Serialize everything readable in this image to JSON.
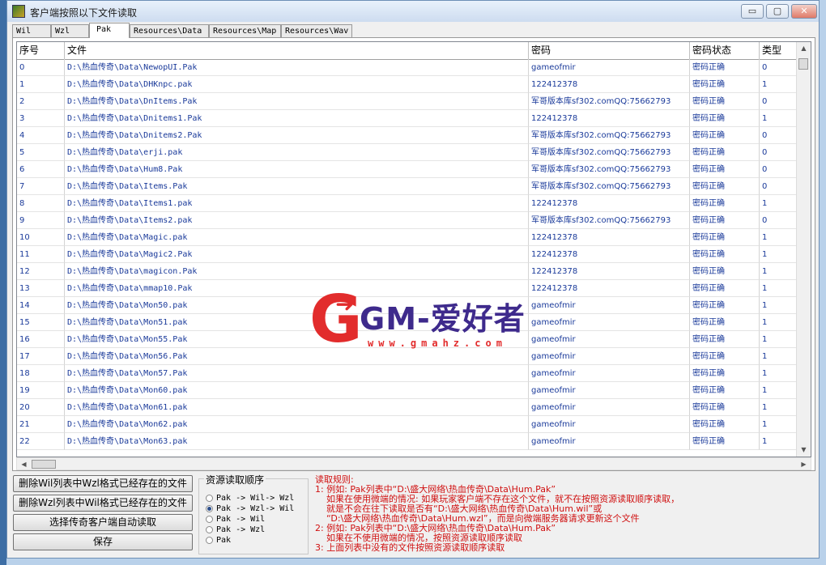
{
  "window": {
    "title": "客户端按照以下文件读取",
    "controls": {
      "minimize": "▭",
      "maximize": "▢",
      "close": "✕"
    }
  },
  "tabs": [
    {
      "label": "Wil",
      "active": false
    },
    {
      "label": "Wzl",
      "active": false
    },
    {
      "label": "Pak",
      "active": true
    },
    {
      "label": "Resources\\Data",
      "active": false
    },
    {
      "label": "Resources\\Map",
      "active": false
    },
    {
      "label": "Resources\\Wav",
      "active": false
    }
  ],
  "table": {
    "headers": [
      "序号",
      "文件",
      "密码",
      "密码状态",
      "类型"
    ],
    "rows": [
      [
        "0",
        "D:\\热血传奇\\Data\\NewopUI.Pak",
        "gameofmir",
        "密码正确",
        "0"
      ],
      [
        "1",
        "D:\\热血传奇\\Data\\DHKnpc.pak",
        "122412378",
        "密码正确",
        "1"
      ],
      [
        "2",
        "D:\\热血传奇\\Data\\DnItems.Pak",
        "军哥版本库sf302.comQQ:75662793",
        "密码正确",
        "0"
      ],
      [
        "3",
        "D:\\热血传奇\\Data\\Dnitems1.Pak",
        "122412378",
        "密码正确",
        "1"
      ],
      [
        "4",
        "D:\\热血传奇\\Data\\Dnitems2.Pak",
        "军哥版本库sf302.comQQ:75662793",
        "密码正确",
        "0"
      ],
      [
        "5",
        "D:\\热血传奇\\Data\\erji.pak",
        "军哥版本库sf302.comQQ:75662793",
        "密码正确",
        "0"
      ],
      [
        "6",
        "D:\\热血传奇\\Data\\Hum8.Pak",
        "军哥版本库sf302.comQQ:75662793",
        "密码正确",
        "0"
      ],
      [
        "7",
        "D:\\热血传奇\\Data\\Items.Pak",
        "军哥版本库sf302.comQQ:75662793",
        "密码正确",
        "0"
      ],
      [
        "8",
        "D:\\热血传奇\\Data\\Items1.pak",
        "122412378",
        "密码正确",
        "1"
      ],
      [
        "9",
        "D:\\热血传奇\\Data\\Items2.pak",
        "军哥版本库sf302.comQQ:75662793",
        "密码正确",
        "0"
      ],
      [
        "10",
        "D:\\热血传奇\\Data\\Magic.pak",
        "122412378",
        "密码正确",
        "1"
      ],
      [
        "11",
        "D:\\热血传奇\\Data\\Magic2.Pak",
        "122412378",
        "密码正确",
        "1"
      ],
      [
        "12",
        "D:\\热血传奇\\Data\\magicon.Pak",
        "122412378",
        "密码正确",
        "1"
      ],
      [
        "13",
        "D:\\热血传奇\\Data\\mmap10.Pak",
        "122412378",
        "密码正确",
        "1"
      ],
      [
        "14",
        "D:\\热血传奇\\Data\\Mon50.pak",
        "gameofmir",
        "密码正确",
        "1"
      ],
      [
        "15",
        "D:\\热血传奇\\Data\\Mon51.pak",
        "gameofmir",
        "密码正确",
        "1"
      ],
      [
        "16",
        "D:\\热血传奇\\Data\\Mon55.Pak",
        "gameofmir",
        "密码正确",
        "1"
      ],
      [
        "17",
        "D:\\热血传奇\\Data\\Mon56.Pak",
        "gameofmir",
        "密码正确",
        "1"
      ],
      [
        "18",
        "D:\\热血传奇\\Data\\Mon57.Pak",
        "gameofmir",
        "密码正确",
        "1"
      ],
      [
        "19",
        "D:\\热血传奇\\Data\\Mon60.pak",
        "gameofmir",
        "密码正确",
        "1"
      ],
      [
        "20",
        "D:\\热血传奇\\Data\\Mon61.pak",
        "gameofmir",
        "密码正确",
        "1"
      ],
      [
        "21",
        "D:\\热血传奇\\Data\\Mon62.pak",
        "gameofmir",
        "密码正确",
        "1"
      ],
      [
        "22",
        "D:\\热血传奇\\Data\\Mon63.pak",
        "gameofmir",
        "密码正确",
        "1"
      ]
    ]
  },
  "buttons": {
    "delete_wil": "删除Wil列表中Wzl格式已经存在的文件",
    "delete_wzl": "删除Wzl列表中Wil格式已经存在的文件",
    "auto_read": "选择传奇客户端自动读取",
    "save": "保存"
  },
  "resource_order": {
    "title": "资源读取顺序",
    "options": [
      {
        "label": "Pak -> Wil-> Wzl",
        "selected": false
      },
      {
        "label": "Pak -> Wzl-> Wil",
        "selected": true
      },
      {
        "label": "Pak -> Wil",
        "selected": false
      },
      {
        "label": "Pak -> Wzl",
        "selected": false
      },
      {
        "label": "Pak",
        "selected": false
      }
    ]
  },
  "rules": [
    "读取规则:",
    "1: 例如: Pak列表中“D:\\盛大网络\\热血传奇\\Data\\Hum.Pak”",
    "    如果在使用微端的情况: 如果玩家客户端不存在这个文件，就不在按照资源读取顺序读取，",
    "    就是不会在往下读取是否有“D:\\盛大网络\\热血传奇\\Data\\Hum.wil”或",
    "    “D:\\盛大网络\\热血传奇\\Data\\Hum.wzl”，而是向微端服务器请求更新这个文件",
    "2: 例如: Pak列表中“D:\\盛大网络\\热血传奇\\Data\\Hum.Pak”",
    "    如果在不使用微端的情况，按照资源读取顺序读取",
    "3: 上面列表中没有的文件按照资源读取顺序读取"
  ],
  "watermark": {
    "text": "GM-爱好者",
    "url": "www.gmahz.com",
    "letter": "G"
  },
  "colors": {
    "rules": "#d01010",
    "cell_text": "#1a3a9a",
    "watermark_red": "#e22c2c",
    "watermark_purple": "#3e2a8c"
  }
}
